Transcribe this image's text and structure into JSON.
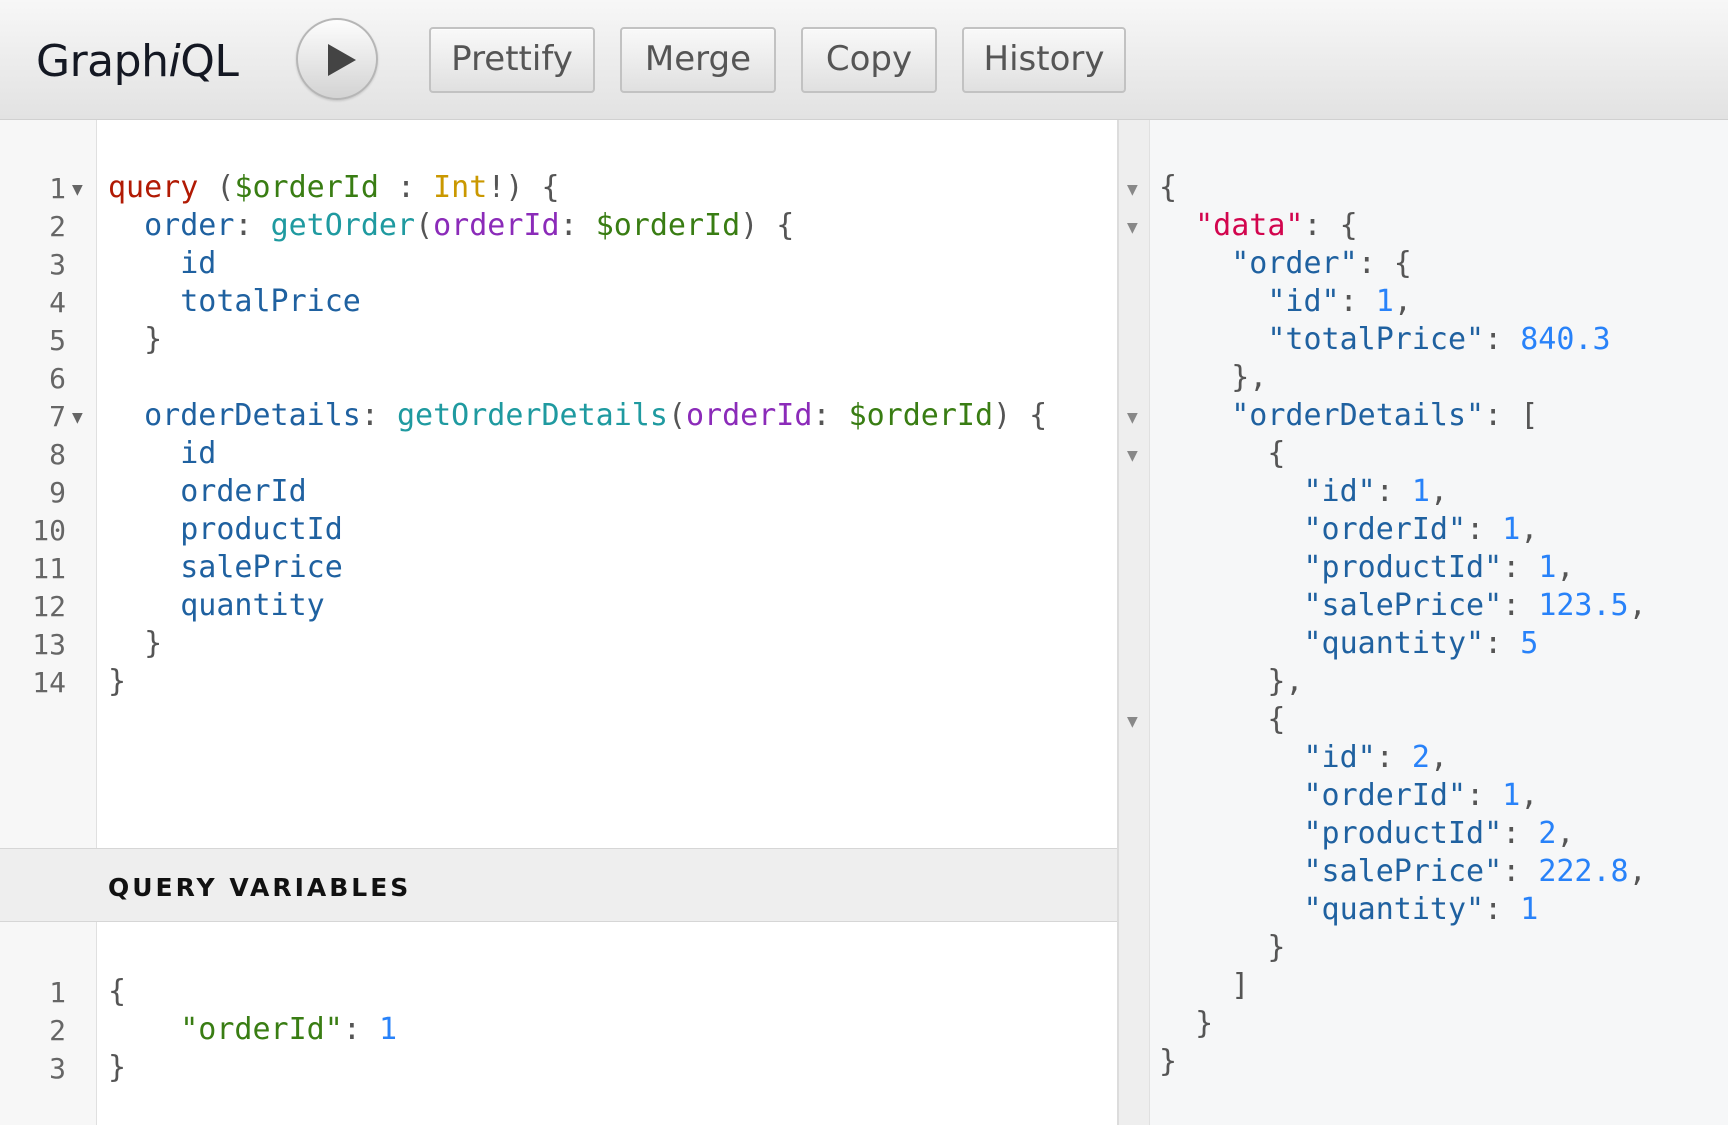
{
  "app": {
    "title_pre": "Graph",
    "title_em": "i",
    "title_post": "QL"
  },
  "toolbar": {
    "execute_icon": "play-icon",
    "prettify_label": "Prettify",
    "merge_label": "Merge",
    "copy_label": "Copy",
    "history_label": "History"
  },
  "query_editor": {
    "line_numbers": [
      "1",
      "2",
      "3",
      "4",
      "5",
      "6",
      "7",
      "8",
      "9",
      "10",
      "11",
      "12",
      "13",
      "14"
    ],
    "lines": [
      [
        {
          "t": "query",
          "c": "kw"
        },
        {
          "t": " (",
          "c": "punc"
        },
        {
          "t": "$orderId",
          "c": "var"
        },
        {
          "t": " : ",
          "c": "punc"
        },
        {
          "t": "Int",
          "c": "type"
        },
        {
          "t": "!) {",
          "c": "punc"
        }
      ],
      [
        {
          "t": "  order",
          "c": "field"
        },
        {
          "t": ": ",
          "c": "punc"
        },
        {
          "t": "getOrder",
          "c": "fn"
        },
        {
          "t": "(",
          "c": "punc"
        },
        {
          "t": "orderId",
          "c": "arg"
        },
        {
          "t": ": ",
          "c": "punc"
        },
        {
          "t": "$orderId",
          "c": "var"
        },
        {
          "t": ") {",
          "c": "punc"
        }
      ],
      [
        {
          "t": "    id",
          "c": "field"
        }
      ],
      [
        {
          "t": "    totalPrice",
          "c": "field"
        }
      ],
      [
        {
          "t": "  }",
          "c": "punc"
        }
      ],
      [],
      [
        {
          "t": "  orderDetails",
          "c": "field"
        },
        {
          "t": ": ",
          "c": "punc"
        },
        {
          "t": "getOrderDetails",
          "c": "fn"
        },
        {
          "t": "(",
          "c": "punc"
        },
        {
          "t": "orderId",
          "c": "arg"
        },
        {
          "t": ": ",
          "c": "punc"
        },
        {
          "t": "$orderId",
          "c": "var"
        },
        {
          "t": ") {",
          "c": "punc"
        }
      ],
      [
        {
          "t": "    id",
          "c": "field"
        }
      ],
      [
        {
          "t": "    orderId",
          "c": "field"
        }
      ],
      [
        {
          "t": "    productId",
          "c": "field"
        }
      ],
      [
        {
          "t": "    salePrice",
          "c": "field"
        }
      ],
      [
        {
          "t": "    quantity",
          "c": "field"
        }
      ],
      [
        {
          "t": "  }",
          "c": "punc"
        }
      ],
      [
        {
          "t": "}",
          "c": "punc"
        }
      ]
    ]
  },
  "query_variables": {
    "title": "QUERY VARIABLES",
    "line_numbers": [
      "1",
      "2",
      "3"
    ],
    "lines": [
      [
        {
          "t": "{",
          "c": "punc"
        }
      ],
      [
        {
          "t": "    ",
          "c": "punc"
        },
        {
          "t": "\"orderId\"",
          "c": "vkey"
        },
        {
          "t": ": ",
          "c": "punc"
        },
        {
          "t": "1",
          "c": "jnum"
        }
      ],
      [
        {
          "t": "}",
          "c": "punc"
        }
      ]
    ]
  },
  "result": {
    "lines": [
      [
        {
          "t": "{",
          "c": "punc"
        }
      ],
      [
        {
          "t": "  ",
          "c": "punc"
        },
        {
          "t": "\"data\"",
          "c": "jdata"
        },
        {
          "t": ": {",
          "c": "punc"
        }
      ],
      [
        {
          "t": "    ",
          "c": "punc"
        },
        {
          "t": "\"order\"",
          "c": "jkey"
        },
        {
          "t": ": {",
          "c": "punc"
        }
      ],
      [
        {
          "t": "      ",
          "c": "punc"
        },
        {
          "t": "\"id\"",
          "c": "jkey"
        },
        {
          "t": ": ",
          "c": "punc"
        },
        {
          "t": "1",
          "c": "jnum"
        },
        {
          "t": ",",
          "c": "punc"
        }
      ],
      [
        {
          "t": "      ",
          "c": "punc"
        },
        {
          "t": "\"totalPrice\"",
          "c": "jkey"
        },
        {
          "t": ": ",
          "c": "punc"
        },
        {
          "t": "840.3",
          "c": "jnum"
        }
      ],
      [
        {
          "t": "    },",
          "c": "punc"
        }
      ],
      [
        {
          "t": "    ",
          "c": "punc"
        },
        {
          "t": "\"orderDetails\"",
          "c": "jkey"
        },
        {
          "t": ": [",
          "c": "punc"
        }
      ],
      [
        {
          "t": "      {",
          "c": "punc"
        }
      ],
      [
        {
          "t": "        ",
          "c": "punc"
        },
        {
          "t": "\"id\"",
          "c": "jkey"
        },
        {
          "t": ": ",
          "c": "punc"
        },
        {
          "t": "1",
          "c": "jnum"
        },
        {
          "t": ",",
          "c": "punc"
        }
      ],
      [
        {
          "t": "        ",
          "c": "punc"
        },
        {
          "t": "\"orderId\"",
          "c": "jkey"
        },
        {
          "t": ": ",
          "c": "punc"
        },
        {
          "t": "1",
          "c": "jnum"
        },
        {
          "t": ",",
          "c": "punc"
        }
      ],
      [
        {
          "t": "        ",
          "c": "punc"
        },
        {
          "t": "\"productId\"",
          "c": "jkey"
        },
        {
          "t": ": ",
          "c": "punc"
        },
        {
          "t": "1",
          "c": "jnum"
        },
        {
          "t": ",",
          "c": "punc"
        }
      ],
      [
        {
          "t": "        ",
          "c": "punc"
        },
        {
          "t": "\"salePrice\"",
          "c": "jkey"
        },
        {
          "t": ": ",
          "c": "punc"
        },
        {
          "t": "123.5",
          "c": "jnum"
        },
        {
          "t": ",",
          "c": "punc"
        }
      ],
      [
        {
          "t": "        ",
          "c": "punc"
        },
        {
          "t": "\"quantity\"",
          "c": "jkey"
        },
        {
          "t": ": ",
          "c": "punc"
        },
        {
          "t": "5",
          "c": "jnum"
        }
      ],
      [
        {
          "t": "      },",
          "c": "punc"
        }
      ],
      [
        {
          "t": "      {",
          "c": "punc"
        }
      ],
      [
        {
          "t": "        ",
          "c": "punc"
        },
        {
          "t": "\"id\"",
          "c": "jkey"
        },
        {
          "t": ": ",
          "c": "punc"
        },
        {
          "t": "2",
          "c": "jnum"
        },
        {
          "t": ",",
          "c": "punc"
        }
      ],
      [
        {
          "t": "        ",
          "c": "punc"
        },
        {
          "t": "\"orderId\"",
          "c": "jkey"
        },
        {
          "t": ": ",
          "c": "punc"
        },
        {
          "t": "1",
          "c": "jnum"
        },
        {
          "t": ",",
          "c": "punc"
        }
      ],
      [
        {
          "t": "        ",
          "c": "punc"
        },
        {
          "t": "\"productId\"",
          "c": "jkey"
        },
        {
          "t": ": ",
          "c": "punc"
        },
        {
          "t": "2",
          "c": "jnum"
        },
        {
          "t": ",",
          "c": "punc"
        }
      ],
      [
        {
          "t": "        ",
          "c": "punc"
        },
        {
          "t": "\"salePrice\"",
          "c": "jkey"
        },
        {
          "t": ": ",
          "c": "punc"
        },
        {
          "t": "222.8",
          "c": "jnum"
        },
        {
          "t": ",",
          "c": "punc"
        }
      ],
      [
        {
          "t": "        ",
          "c": "punc"
        },
        {
          "t": "\"quantity\"",
          "c": "jkey"
        },
        {
          "t": ": ",
          "c": "punc"
        },
        {
          "t": "1",
          "c": "jnum"
        }
      ],
      [
        {
          "t": "      }",
          "c": "punc"
        }
      ],
      [
        {
          "t": "    ]",
          "c": "punc"
        }
      ],
      [
        {
          "t": "  }",
          "c": "punc"
        }
      ],
      [
        {
          "t": "}",
          "c": "punc"
        }
      ]
    ]
  }
}
